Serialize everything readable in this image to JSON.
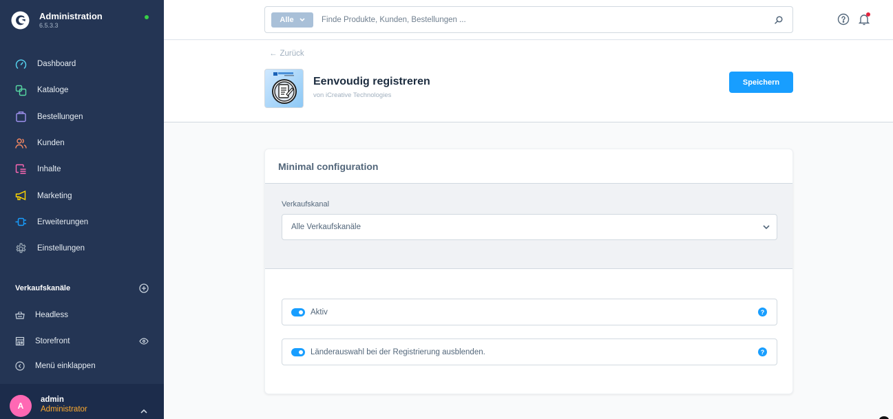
{
  "app": {
    "title": "Administration",
    "version": "6.5.3.3",
    "status_color": "#37d046"
  },
  "sidebar": {
    "items": [
      {
        "label": "Dashboard",
        "icon": "dashboard-icon",
        "color": "#57d9f5"
      },
      {
        "label": "Kataloge",
        "icon": "catalog-icon",
        "color": "#57d9a3"
      },
      {
        "label": "Bestellungen",
        "icon": "orders-icon",
        "color": "#a092f0"
      },
      {
        "label": "Kunden",
        "icon": "customers-icon",
        "color": "#f88962"
      },
      {
        "label": "Inhalte",
        "icon": "content-icon",
        "color": "#ff68b4"
      },
      {
        "label": "Marketing",
        "icon": "marketing-icon",
        "color": "#ffd700"
      },
      {
        "label": "Erweiterungen",
        "icon": "extensions-icon",
        "color": "#189eff"
      },
      {
        "label": "Einstellungen",
        "icon": "settings-icon",
        "color": "#9aa8b5"
      }
    ],
    "sales_channels": {
      "title": "Verkaufskanäle",
      "items": [
        {
          "label": "Headless",
          "icon": "basket-icon"
        },
        {
          "label": "Storefront",
          "icon": "storefront-icon"
        }
      ]
    },
    "collapse_label": "Menü einklappen",
    "user": {
      "initial": "A",
      "name": "admin",
      "role": "Administrator"
    }
  },
  "topbar": {
    "search_type": "Alle",
    "search_placeholder": "Finde Produkte, Kunden, Bestellungen ..."
  },
  "smartbar": {
    "back_label": "Zurück",
    "plugin_title": "Eenvoudig registreren",
    "plugin_subtitle": "von iCreative Technologies",
    "save_label": "Speichern",
    "accent": "#189eff"
  },
  "card": {
    "title": "Minimal configuration",
    "sales_channel_label": "Verkaufskanal",
    "sales_channel_value": "Alle Verkaufskanäle",
    "switches": [
      {
        "label": "Aktiv",
        "enabled": true
      },
      {
        "label": "Länderauswahl bei der Registrierung ausblenden.",
        "enabled": true
      }
    ],
    "help_glyph": "?"
  }
}
